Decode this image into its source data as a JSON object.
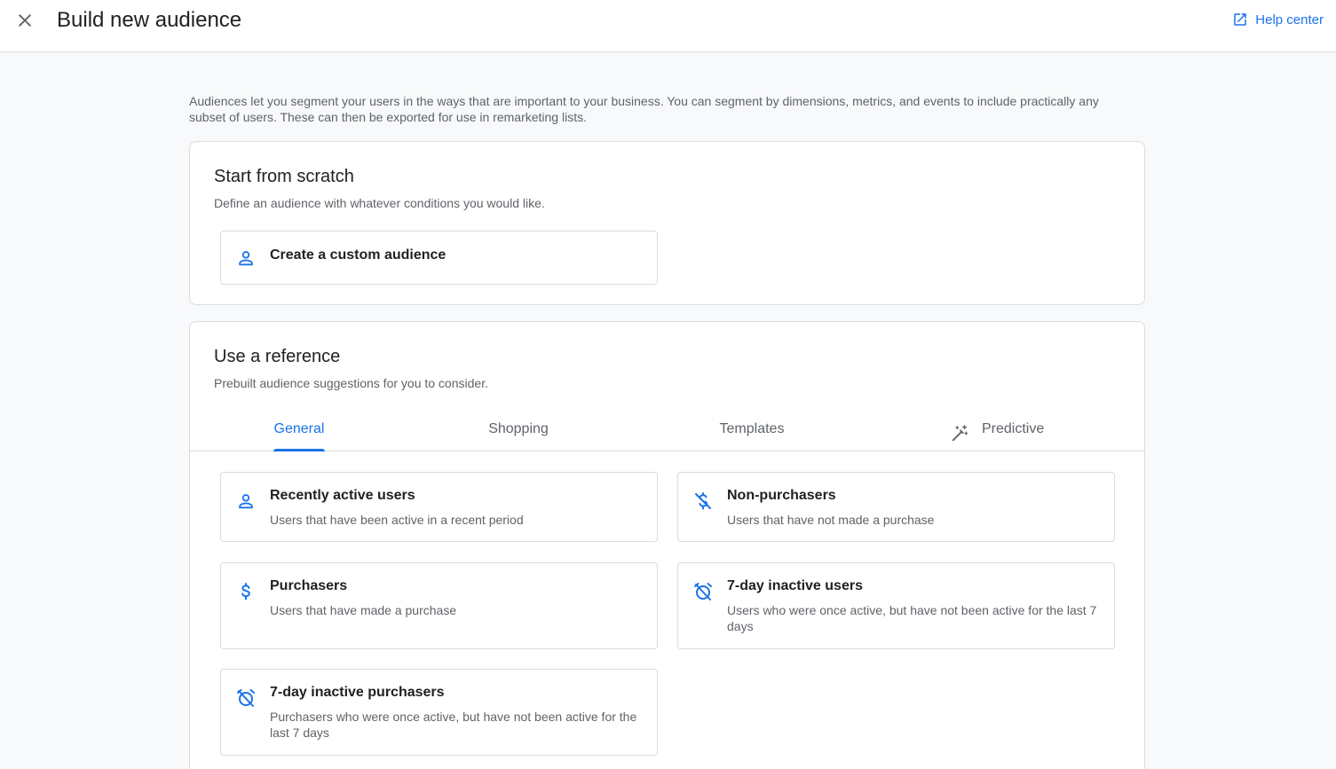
{
  "header": {
    "title": "Build new audience",
    "help_label": "Help center"
  },
  "intro_text": "Audiences let you segment your users in the ways that are important to your business. You can segment by dimensions, metrics, and events to include practically any subset of users. These can then be exported for use in remarketing lists.",
  "scratch": {
    "title": "Start from scratch",
    "subtitle": "Define an audience with whatever conditions you would like.",
    "custom_label": "Create a custom audience"
  },
  "reference": {
    "title": "Use a reference",
    "subtitle": "Prebuilt audience suggestions for you to consider.",
    "tabs": [
      "General",
      "Shopping",
      "Templates",
      "Predictive"
    ],
    "active_tab": "General",
    "options": [
      {
        "title": "Recently active users",
        "desc": "Users that have been active in a recent period",
        "icon": "person-icon"
      },
      {
        "title": "Non-purchasers",
        "desc": "Users that have not made a purchase",
        "icon": "money-off-icon"
      },
      {
        "title": "Purchasers",
        "desc": "Users that have made a purchase",
        "icon": "dollar-icon"
      },
      {
        "title": "7-day inactive users",
        "desc": "Users who were once active, but have not been active for the last 7 days",
        "icon": "alarm-off-icon"
      },
      {
        "title": "7-day inactive purchasers",
        "desc": "Purchasers who were once active, but have not been active for the last 7 days",
        "icon": "alarm-off-icon"
      }
    ]
  },
  "colors": {
    "accent": "#1a73e8",
    "text": "#202124",
    "muted": "#5f6368",
    "border": "#dadce0",
    "background": "#f8f9fa"
  }
}
